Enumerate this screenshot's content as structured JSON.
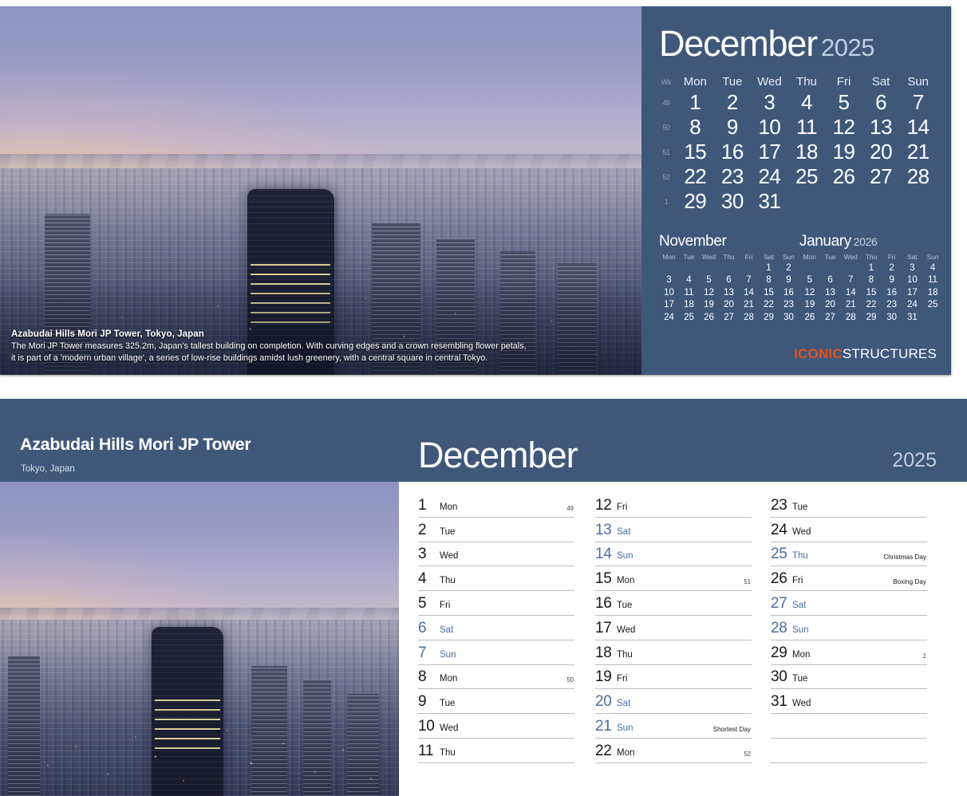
{
  "brand": {
    "part1": "ICONIC",
    "part2": "STRUCTURES",
    "accent_color": "#e1561f"
  },
  "theme": {
    "navy": "#3f587a",
    "weekend_blue": "#4a6d9e",
    "rule": "#b9bcc1"
  },
  "top_panel": {
    "photo": {
      "caption_title": "Azabudai Hills Mori JP Tower, Tokyo, Japan",
      "caption_line1": "The Mori JP Tower measures 325.2m, Japan's tallest building on completion. With curving edges and a crown resembling flower petals,",
      "caption_line2": "it is part of a 'modern urban village', a series of low-rise buildings amidst lush greenery, with a central square in central Tokyo."
    },
    "calendar": {
      "month": "December",
      "year": "2025",
      "wk_header": "Wk",
      "day_headers": [
        "Mon",
        "Tue",
        "Wed",
        "Thu",
        "Fri",
        "Sat",
        "Sun"
      ],
      "weeks": [
        {
          "wk": "49",
          "days": [
            "1",
            "2",
            "3",
            "4",
            "5",
            "6",
            "7"
          ]
        },
        {
          "wk": "50",
          "days": [
            "8",
            "9",
            "10",
            "11",
            "12",
            "13",
            "14"
          ]
        },
        {
          "wk": "51",
          "days": [
            "15",
            "16",
            "17",
            "18",
            "19",
            "20",
            "21"
          ]
        },
        {
          "wk": "52",
          "days": [
            "22",
            "23",
            "24",
            "25",
            "26",
            "27",
            "28"
          ]
        },
        {
          "wk": "1",
          "days": [
            "29",
            "30",
            "31",
            "",
            "",
            "",
            ""
          ]
        }
      ]
    },
    "mini_prev": {
      "month": "November",
      "year": "",
      "day_headers": [
        "Mon",
        "Tue",
        "Wed",
        "Thu",
        "Fri",
        "Sat",
        "Sun"
      ],
      "weeks": [
        [
          "",
          "",
          "",
          "",
          "",
          "1",
          "2"
        ],
        [
          "3",
          "4",
          "5",
          "6",
          "7",
          "8",
          "9"
        ],
        [
          "10",
          "11",
          "12",
          "13",
          "14",
          "15",
          "16"
        ],
        [
          "17",
          "18",
          "19",
          "20",
          "21",
          "22",
          "23"
        ],
        [
          "24",
          "25",
          "26",
          "27",
          "28",
          "29",
          "30"
        ]
      ]
    },
    "mini_next": {
      "month": "January",
      "year": "2026",
      "day_headers": [
        "Mon",
        "Tue",
        "Wed",
        "Thu",
        "Fri",
        "Sat",
        "Sun"
      ],
      "weeks": [
        [
          "",
          "",
          "",
          "1",
          "2",
          "3",
          "4"
        ],
        [
          "5",
          "6",
          "7",
          "8",
          "9",
          "10",
          "11"
        ],
        [
          "12",
          "13",
          "14",
          "15",
          "16",
          "17",
          "18"
        ],
        [
          "19",
          "20",
          "21",
          "22",
          "23",
          "24",
          "25"
        ],
        [
          "26",
          "27",
          "28",
          "29",
          "30",
          "31",
          ""
        ]
      ]
    }
  },
  "bottom_panel": {
    "header": {
      "location_title": "Azabudai Hills Mori JP Tower",
      "location_sub": "Tokyo, Japan",
      "month": "December",
      "year": "2025"
    },
    "columns": [
      [
        {
          "num": "1",
          "dow": "Mon",
          "wk": "49",
          "note": "",
          "weekend": false
        },
        {
          "num": "2",
          "dow": "Tue",
          "wk": "",
          "note": "",
          "weekend": false
        },
        {
          "num": "3",
          "dow": "Wed",
          "wk": "",
          "note": "",
          "weekend": false
        },
        {
          "num": "4",
          "dow": "Thu",
          "wk": "",
          "note": "",
          "weekend": false
        },
        {
          "num": "5",
          "dow": "Fri",
          "wk": "",
          "note": "",
          "weekend": false
        },
        {
          "num": "6",
          "dow": "Sat",
          "wk": "",
          "note": "",
          "weekend": true
        },
        {
          "num": "7",
          "dow": "Sun",
          "wk": "",
          "note": "",
          "weekend": true
        },
        {
          "num": "8",
          "dow": "Mon",
          "wk": "50",
          "note": "",
          "weekend": false
        },
        {
          "num": "9",
          "dow": "Tue",
          "wk": "",
          "note": "",
          "weekend": false
        },
        {
          "num": "10",
          "dow": "Wed",
          "wk": "",
          "note": "",
          "weekend": false
        },
        {
          "num": "11",
          "dow": "Thu",
          "wk": "",
          "note": "",
          "weekend": false
        }
      ],
      [
        {
          "num": "12",
          "dow": "Fri",
          "wk": "",
          "note": "",
          "weekend": false
        },
        {
          "num": "13",
          "dow": "Sat",
          "wk": "",
          "note": "",
          "weekend": true
        },
        {
          "num": "14",
          "dow": "Sun",
          "wk": "",
          "note": "",
          "weekend": true
        },
        {
          "num": "15",
          "dow": "Mon",
          "wk": "51",
          "note": "",
          "weekend": false
        },
        {
          "num": "16",
          "dow": "Tue",
          "wk": "",
          "note": "",
          "weekend": false
        },
        {
          "num": "17",
          "dow": "Wed",
          "wk": "",
          "note": "",
          "weekend": false
        },
        {
          "num": "18",
          "dow": "Thu",
          "wk": "",
          "note": "",
          "weekend": false
        },
        {
          "num": "19",
          "dow": "Fri",
          "wk": "",
          "note": "",
          "weekend": false
        },
        {
          "num": "20",
          "dow": "Sat",
          "wk": "",
          "note": "",
          "weekend": true
        },
        {
          "num": "21",
          "dow": "Sun",
          "wk": "",
          "note": "Shortest Day",
          "weekend": true
        },
        {
          "num": "22",
          "dow": "Mon",
          "wk": "52",
          "note": "",
          "weekend": false
        }
      ],
      [
        {
          "num": "23",
          "dow": "Tue",
          "wk": "",
          "note": "",
          "weekend": false
        },
        {
          "num": "24",
          "dow": "Wed",
          "wk": "",
          "note": "",
          "weekend": false
        },
        {
          "num": "25",
          "dow": "Thu",
          "wk": "",
          "note": "Christmas Day",
          "weekend": true
        },
        {
          "num": "26",
          "dow": "Fri",
          "wk": "",
          "note": "Boxing Day",
          "weekend": false
        },
        {
          "num": "27",
          "dow": "Sat",
          "wk": "",
          "note": "",
          "weekend": true
        },
        {
          "num": "28",
          "dow": "Sun",
          "wk": "",
          "note": "",
          "weekend": true
        },
        {
          "num": "29",
          "dow": "Mon",
          "wk": "1",
          "note": "",
          "weekend": false
        },
        {
          "num": "30",
          "dow": "Tue",
          "wk": "",
          "note": "",
          "weekend": false
        },
        {
          "num": "31",
          "dow": "Wed",
          "wk": "",
          "note": "",
          "weekend": false
        },
        {
          "num": "",
          "dow": "",
          "wk": "",
          "note": "",
          "weekend": false
        },
        {
          "num": "",
          "dow": "",
          "wk": "",
          "note": "",
          "weekend": false
        }
      ]
    ]
  }
}
